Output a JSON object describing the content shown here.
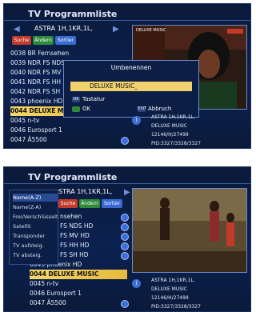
{
  "screen1": {
    "title": "TV Programmliste",
    "satellite": "ASTRA 1H,1KR,1L,",
    "tabs": [
      "Suche",
      "Ändern",
      "Sortier"
    ],
    "channels": [
      {
        "name": "0038 BR Fernsehen",
        "hd": false
      },
      {
        "name": "0039 NDR FS NDS",
        "hd": false
      },
      {
        "name": "0040 NDR FS MV",
        "hd": false
      },
      {
        "name": "0041 NDR FS HH",
        "hd": false
      },
      {
        "name": "0042 NDR FS SH",
        "hd": false
      },
      {
        "name": "0043 phoenix HD",
        "hd": false
      },
      {
        "name": "0044 DELUXE MUSIC",
        "hd": false,
        "selected": true
      },
      {
        "name": "0045 n-tv",
        "hd": false
      },
      {
        "name": "0046 Eurosport 1",
        "hd": false
      },
      {
        "name": "0047 Ä5500",
        "hd": true
      }
    ],
    "dialog": {
      "title": "Umbenennen",
      "input_value": "DELUXE MUSIC_",
      "keyboard_label": "Tastatur",
      "ok_label": "OK",
      "cancel_label": "Abbruch"
    },
    "info": {
      "satellite": "ASTRA 1H,1KR,1L,",
      "channel": "DELUXE MUSIC",
      "freq": "12146/H/27499",
      "pid": "PID:3327/3328/3327"
    },
    "video_label": "DELUXE MUSIC"
  },
  "screen2": {
    "title": "TV Programmliste",
    "satellite": "STRA 1H,1KR,1L,",
    "tabs": [
      "Suche",
      "Ändern",
      "Sortier"
    ],
    "sort_menu": [
      "Name(A-Z)",
      "Name(Z-A)",
      "Frei/Verschlüsselt",
      "Satellit",
      "Transponder",
      "TV aufsteig.",
      "TV absteig."
    ],
    "channels": [
      {
        "name": "nsehen",
        "hd": true
      },
      {
        "name": "FS NDS HD",
        "hd": true
      },
      {
        "name": "FS MV HD",
        "hd": true
      },
      {
        "name": "FS HH HD",
        "hd": true
      },
      {
        "name": "FS SH HD",
        "hd": true
      },
      {
        "name": "0043 phoenix HD",
        "hd": false
      },
      {
        "name": "0044 DELUXE MUSIC",
        "hd": false,
        "selected": true
      },
      {
        "name": "0045 n-tv",
        "hd": false
      },
      {
        "name": "0046 Eurosport 1",
        "hd": false
      },
      {
        "name": "0047 Ä5500",
        "hd": true
      }
    ],
    "info": {
      "satellite": "ASTRA 1H,1KR,1L,",
      "channel": "DELUXE MUSIC",
      "freq": "12146/H/27499",
      "pid": "PID:3327/3328/3327"
    }
  }
}
